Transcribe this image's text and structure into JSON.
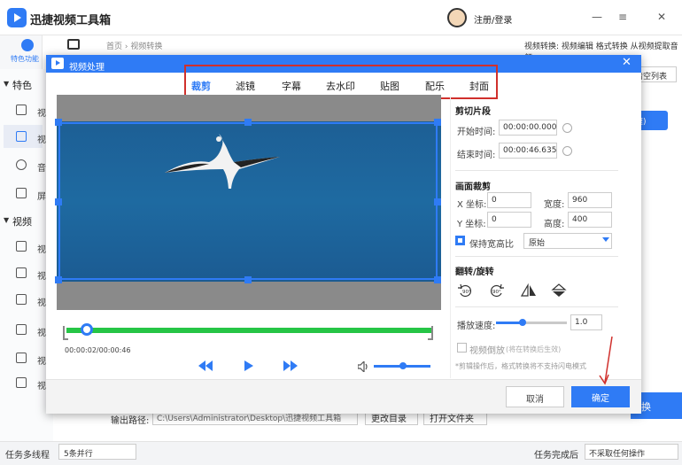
{
  "app": {
    "title": "迅捷视频工具箱",
    "login": "注册/登录",
    "minimize": "—",
    "menu": "≡",
    "close": "✕"
  },
  "nav": {
    "feature_label": "特色功能",
    "section1": "特色",
    "section2": "视频",
    "section1_items": [
      "视",
      "视",
      "音",
      "屏"
    ],
    "section2_items": [
      "视",
      "视",
      "视",
      "视",
      "视",
      "视",
      "音",
      "字"
    ]
  },
  "breadcrumb": "首页 › 视频转换",
  "top_links": "视频转换: 视频编辑  格式转换  从视频提取音频",
  "background": {
    "clear_list": "清空列表",
    "blue_btn": "速)",
    "convert_btn": "换"
  },
  "output": {
    "label": "输出路径:",
    "path": "C:\\Users\\Administrator\\Desktop\\迅捷视频工具箱",
    "change_dir": "更改目录",
    "open_folder": "打开文件夹"
  },
  "statusbar": {
    "multithread_label": "任务多线程",
    "multithread_value": "5条并行",
    "after_label": "任务完成后",
    "after_value": "不采取任何操作"
  },
  "modal": {
    "title": "视频处理",
    "close": "✕",
    "tabs": [
      "裁剪",
      "滤镜",
      "字幕",
      "去水印",
      "贴图",
      "配乐",
      "封面"
    ],
    "active_tab": "裁剪",
    "time_readout": "00:00:02/00:00:46",
    "settings": {
      "clip_title": "剪切片段",
      "start_label": "开始时间:",
      "start_value": "00:00:00.000",
      "end_label": "结束时间:",
      "end_value": "00:00:46.635",
      "crop_title": "画面裁剪",
      "x_label": "X 坐标:",
      "x_value": "0",
      "width_label": "宽度:",
      "width_value": "960",
      "y_label": "Y 坐标:",
      "y_value": "0",
      "height_label": "高度:",
      "height_value": "400",
      "keep_ratio_label": "保持宽高比",
      "ratio_value": "原始",
      "flip_title": "翻转/旋转",
      "rotate_left": "90°",
      "rotate_right": "90°",
      "speed_label": "播放速度:",
      "speed_value": "1.0",
      "reverse_label": "视频倒放",
      "reverse_hint": "(将在转换后生效)",
      "crop_note": "*剪辑操作后，格式转换将不支持闪电模式"
    },
    "footer": {
      "cancel": "取消",
      "confirm": "确定"
    }
  },
  "colors": {
    "accent": "#2f7bf5",
    "timeline": "#26c546",
    "highlight": "#d0302c"
  }
}
